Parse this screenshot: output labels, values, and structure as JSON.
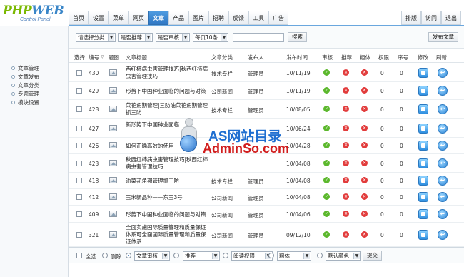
{
  "logo": {
    "brand_a": "PHP",
    "brand_b": "WEB",
    "subtitle": "Control Panel"
  },
  "topnav": [
    "首页",
    "设置",
    "菜单",
    "网页",
    "文章",
    "产品",
    "图片",
    "招聘",
    "反馈",
    "工具",
    "广告"
  ],
  "topnav_active": "文章",
  "rightnav": [
    "排版",
    "访问",
    "退出"
  ],
  "sidebar": [
    "文章管理",
    "文章发布",
    "文章分类",
    "专题管理",
    "模块设置"
  ],
  "filters": {
    "category": "请选择分类",
    "recommend": "是否推荐",
    "audit": "是否审核",
    "per_page": "每页10条",
    "search_value": "",
    "search_button": "搜索",
    "publish_button": "发布文章"
  },
  "columns": [
    "选择",
    "编号",
    "题图",
    "文章标题",
    "文章分类",
    "发布人",
    "发布时间",
    "审核",
    "推荐",
    "粗体",
    "权限",
    "序号",
    "修改",
    "刷新"
  ],
  "rows": [
    {
      "id": "430",
      "title": "西红柿病虫害管理技巧|秋西红柿病虫害管理技巧",
      "category": "技术专栏",
      "author": "管理员",
      "date": "10/11/19",
      "audit": "ok",
      "recommend": "no",
      "bold": "no",
      "perm": "0",
      "order": "0"
    },
    {
      "id": "429",
      "title": "形势下中国种业面临的问题与对策",
      "category": "公司新闻",
      "author": "管理员",
      "date": "10/11/19",
      "audit": "ok",
      "recommend": "no",
      "bold": "no",
      "perm": "0",
      "order": "0"
    },
    {
      "id": "428",
      "title": "菜花角期管理|三防油菜花角期管理抓三防",
      "category": "技术专栏",
      "author": "管理员",
      "date": "10/08/05",
      "audit": "ok",
      "recommend": "no",
      "bold": "no",
      "perm": "0",
      "order": "0"
    },
    {
      "id": "427",
      "title": "新形势下中国种业面临",
      "category": "",
      "author": "",
      "date": "10/06/24",
      "audit": "ok",
      "recommend": "no",
      "bold": "no",
      "perm": "0",
      "order": "0"
    },
    {
      "id": "426",
      "title": "如何正确高效的使用",
      "category": "",
      "author": "",
      "date": "10/04/28",
      "audit": "ok",
      "recommend": "no",
      "bold": "no",
      "perm": "0",
      "order": "0"
    },
    {
      "id": "423",
      "title": "秋西红柿病虫害管理技巧|秋西红柿病虫害管理技巧",
      "category": "",
      "author": "",
      "date": "10/04/08",
      "audit": "ok",
      "recommend": "no",
      "bold": "no",
      "perm": "0",
      "order": "0"
    },
    {
      "id": "418",
      "title": "油菜花角期管理抓三防",
      "category": "技术专栏",
      "author": "管理员",
      "date": "10/04/08",
      "audit": "ok",
      "recommend": "no",
      "bold": "no",
      "perm": "0",
      "order": "0"
    },
    {
      "id": "412",
      "title": "玉米新品种——东玉3号",
      "category": "公司新闻",
      "author": "管理员",
      "date": "10/04/08",
      "audit": "ok",
      "recommend": "no",
      "bold": "no",
      "perm": "0",
      "order": "0"
    },
    {
      "id": "409",
      "title": "形势下中国种业面临的问题与对策",
      "category": "公司新闻",
      "author": "管理员",
      "date": "10/04/06",
      "audit": "ok",
      "recommend": "no",
      "bold": "no",
      "perm": "0",
      "order": "0"
    },
    {
      "id": "321",
      "title": "全面实施国际质量管理和质量保证体系可全面国际质量管理和质量保证体系",
      "category": "公司新闻",
      "author": "管理员",
      "date": "09/12/10",
      "audit": "ok",
      "recommend": "no",
      "bold": "no",
      "perm": "0",
      "order": "0"
    }
  ],
  "bottom": {
    "select_all": "全选",
    "delete": "删除",
    "audit_select": "文章审核",
    "recommend_select": "推荐",
    "perm_select": "阅读权限",
    "bold_select": "粗体",
    "color_select": "默认颜色",
    "submit": "提交"
  },
  "watermark": {
    "line1": "AS网站目录",
    "line2": "AdminSo.com"
  },
  "colors": {
    "accent": "#2f77c4",
    "ok": "#5cb82d",
    "no": "#e23c3c",
    "watermark_blue": "#1f6fd1",
    "watermark_red": "#d11d1d"
  }
}
